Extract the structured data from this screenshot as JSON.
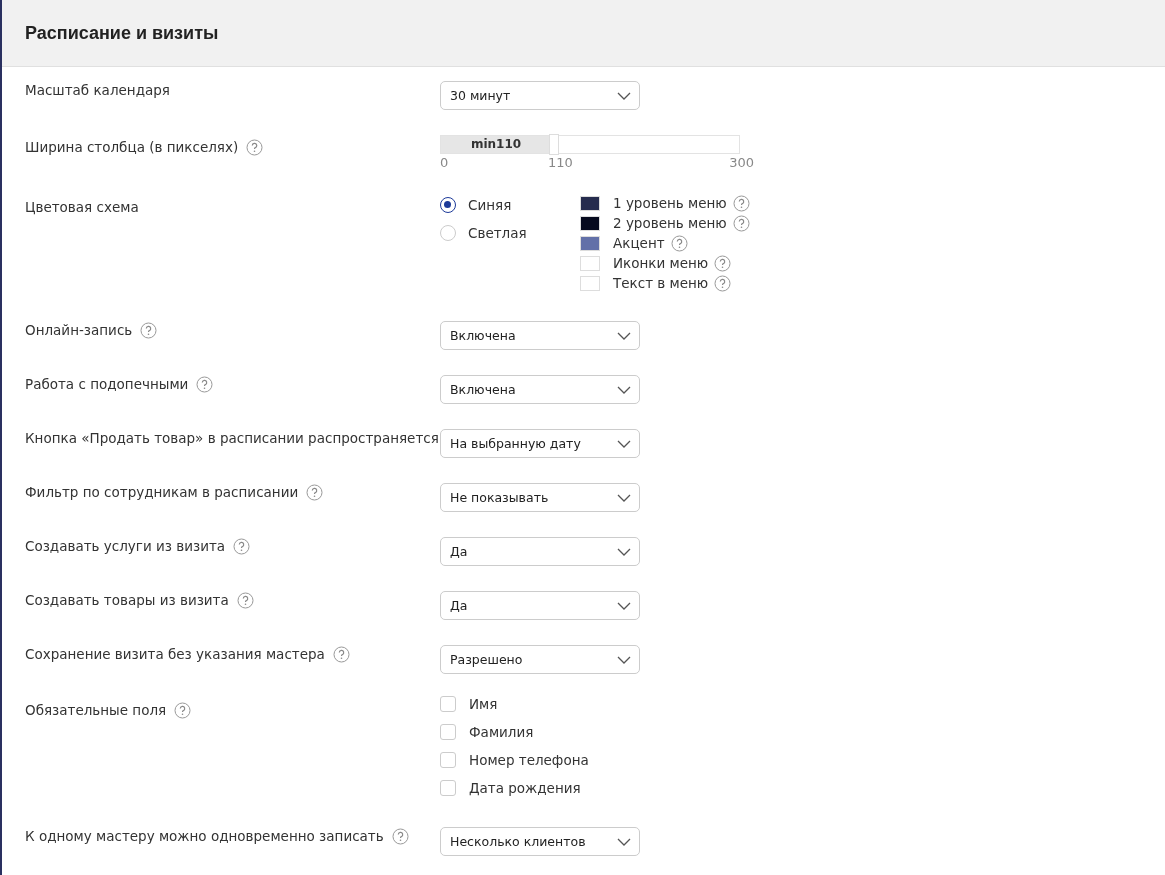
{
  "header": {
    "title": "Расписание и визиты"
  },
  "settings": [
    {
      "kind": "select",
      "label": "Масштаб календаря",
      "help": false,
      "value": "30 минут"
    },
    {
      "kind": "slider",
      "label": "Ширина столбца (в пикселях)",
      "help": true,
      "fill_label": "min110",
      "level": 0.3667,
      "min": "0",
      "current": "110",
      "max": "300"
    },
    {
      "kind": "scheme",
      "label": "Цветовая схема",
      "help": false,
      "options": [
        {
          "label": "Синяя",
          "selected": true
        },
        {
          "label": "Светлая",
          "selected": false
        }
      ],
      "swatches": [
        {
          "label": "1 уровень меню",
          "color": "#262c4e"
        },
        {
          "label": "2 уровень меню",
          "color": "#060a1e"
        },
        {
          "label": "Акцент",
          "color": "#6270a8"
        },
        {
          "label": "Иконки меню",
          "color": "#ffffff"
        },
        {
          "label": "Текст в меню",
          "color": "#ffffff"
        }
      ]
    },
    {
      "kind": "select",
      "label": "Онлайн-запись",
      "help": true,
      "value": "Включена"
    },
    {
      "kind": "select",
      "label": "Работа с подопечными",
      "help": true,
      "value": "Включена"
    },
    {
      "kind": "select",
      "label": "Кнопка «Продать товар» в расписании распространяется",
      "help": false,
      "value": "На выбранную дату"
    },
    {
      "kind": "select",
      "label": "Фильтр по сотрудникам в расписании",
      "help": true,
      "value": "Не показывать"
    },
    {
      "kind": "select",
      "label": "Создавать услуги из визита",
      "help": true,
      "value": "Да"
    },
    {
      "kind": "select",
      "label": "Создавать товары из визита",
      "help": true,
      "value": "Да"
    },
    {
      "kind": "select",
      "label": "Сохранение визита без указания мастера",
      "help": true,
      "value": "Разрешено"
    },
    {
      "kind": "checks",
      "label": "Обязательные поля",
      "help": true,
      "items": [
        {
          "label": "Имя",
          "checked": false
        },
        {
          "label": "Фамилия",
          "checked": false
        },
        {
          "label": "Номер телефона",
          "checked": false
        },
        {
          "label": "Дата рождения",
          "checked": false
        }
      ]
    },
    {
      "kind": "select",
      "label": "К одному мастеру можно одновременно записать",
      "help": true,
      "value": "Несколько клиентов"
    }
  ]
}
